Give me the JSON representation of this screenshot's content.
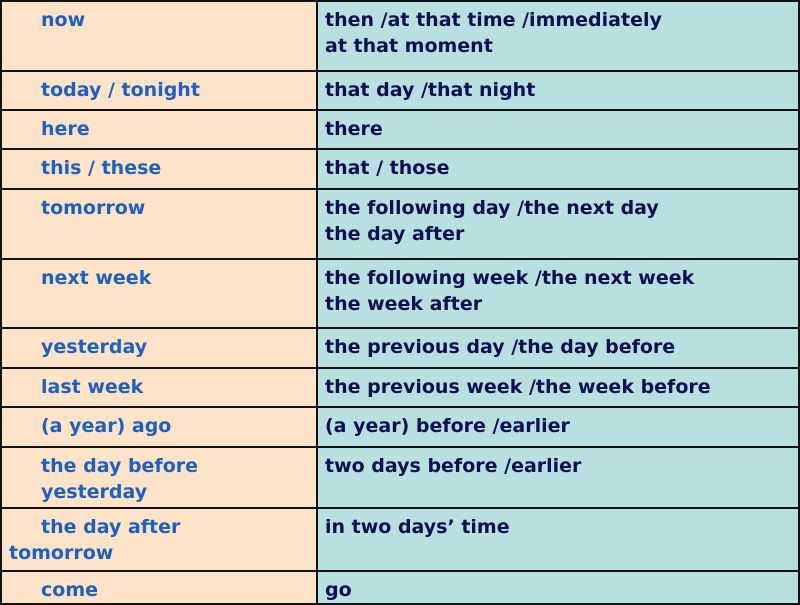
{
  "colors": {
    "left_bg": "#fde4c8",
    "right_bg": "#b9e0e0",
    "left_text": "#1f5fc0",
    "right_text": "#0d1050"
  },
  "rows": [
    {
      "direct": [
        "now"
      ],
      "reported": [
        "then /at that time /immediately",
        "at that moment"
      ]
    },
    {
      "direct": [
        "today / tonight"
      ],
      "reported": [
        "that day /that night"
      ]
    },
    {
      "direct": [
        "here"
      ],
      "reported": [
        "there"
      ]
    },
    {
      "direct": [
        "this / these"
      ],
      "reported": [
        "that / those"
      ]
    },
    {
      "direct": [
        "tomorrow"
      ],
      "reported": [
        "the following day /the next day",
        "the day after"
      ]
    },
    {
      "direct": [
        "next week"
      ],
      "reported": [
        "the following week /the next week",
        "the week after"
      ]
    },
    {
      "direct": [
        "yesterday"
      ],
      "reported": [
        "the previous day /the day before"
      ]
    },
    {
      "direct": [
        "last week"
      ],
      "reported": [
        "the previous week /the week before"
      ]
    },
    {
      "direct": [
        "(a year) ago"
      ],
      "reported": [
        "(a year) before /earlier"
      ]
    },
    {
      "direct": [
        "the day before",
        "yesterday"
      ],
      "reported": [
        "two days before /earlier"
      ]
    },
    {
      "direct": [
        "the day after",
        "tomorrow"
      ],
      "reported": [
        "in two days’ time"
      ]
    },
    {
      "direct": [
        "come"
      ],
      "reported": [
        "go"
      ]
    }
  ]
}
